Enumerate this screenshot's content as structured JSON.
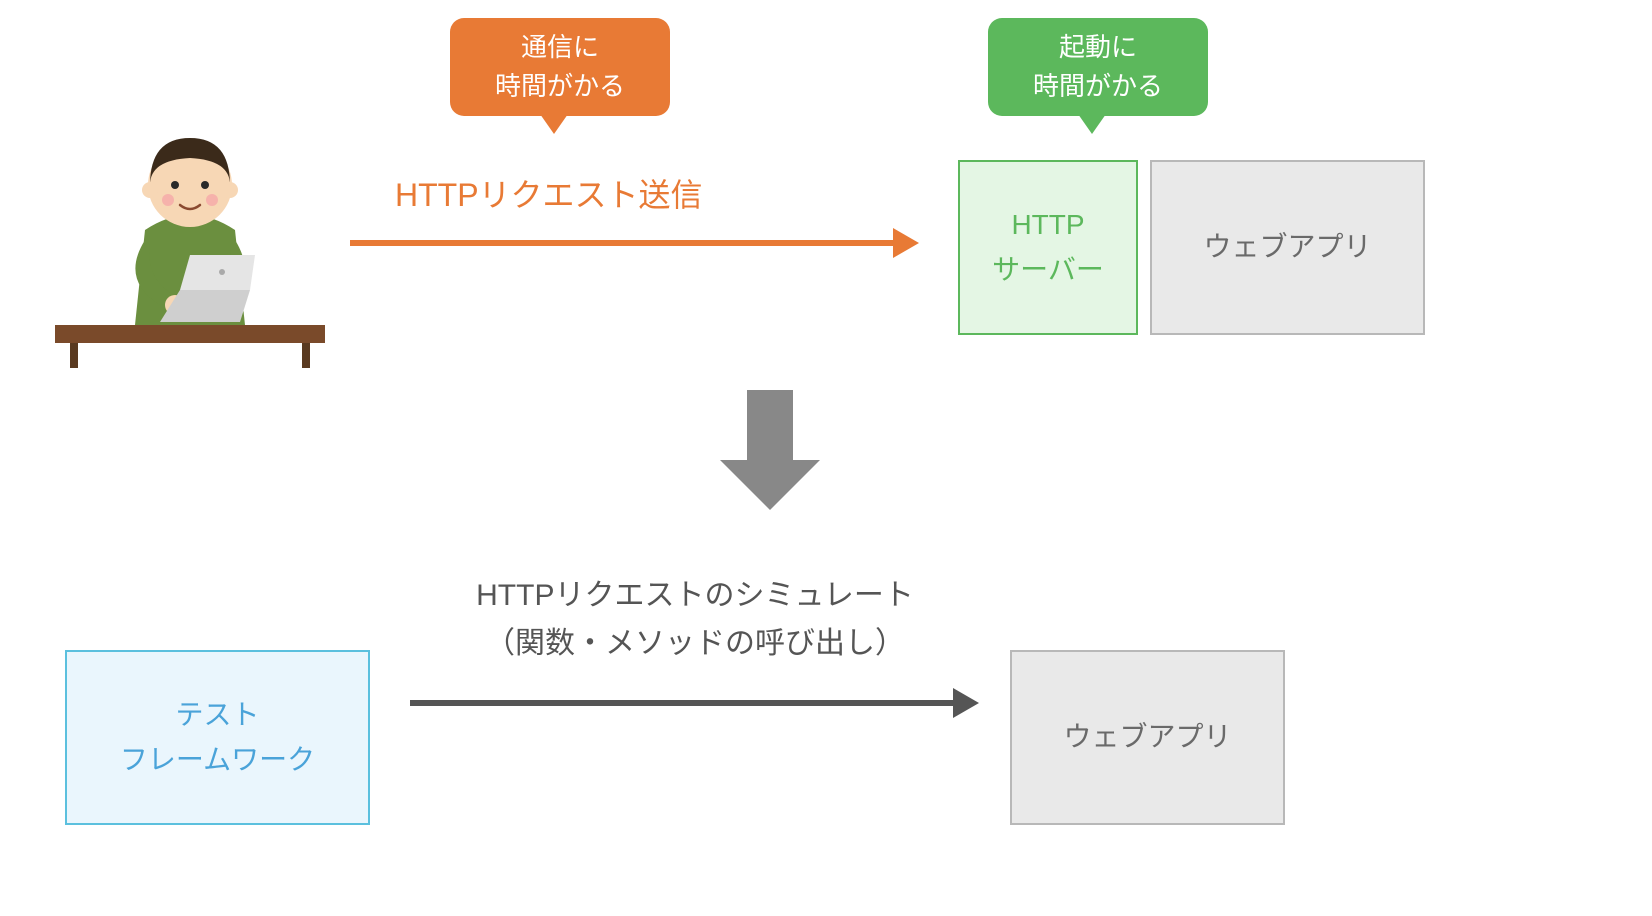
{
  "top": {
    "bubble_comm": "通信に\n時間がかる",
    "bubble_boot": "起動に\n時間がかる",
    "arrow_label": "HTTPリクエスト送信",
    "http_server": "HTTP\nサーバー",
    "web_app": "ウェブアプリ"
  },
  "bottom": {
    "arrow_label_1": "HTTPリクエストのシミュレート",
    "arrow_label_2": "（関数・メソッドの呼び出し）",
    "test_framework": "テスト\nフレームワーク",
    "web_app": "ウェブアプリ"
  },
  "colors": {
    "orange": "#e87a35",
    "green": "#5cb85c",
    "gray_box_bg": "#e9e9e9",
    "gray_box_border": "#b8b8b8",
    "blue_border": "#5bc0de",
    "arrow_gray": "#555555"
  }
}
